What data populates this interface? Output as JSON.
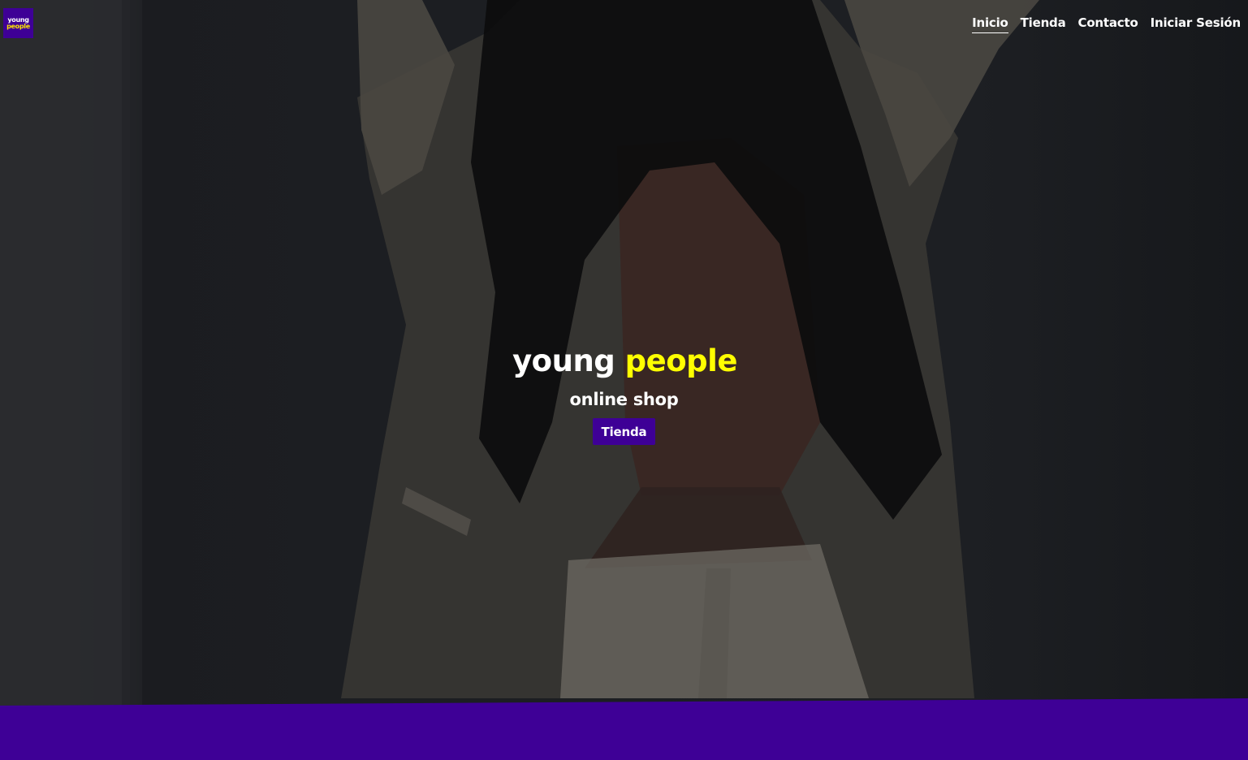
{
  "logo": {
    "line1": "young",
    "line2": "people"
  },
  "nav": {
    "items": [
      {
        "label": "Inicio",
        "active": true
      },
      {
        "label": "Tienda",
        "active": false
      },
      {
        "label": "Contacto",
        "active": false
      },
      {
        "label": "Iniciar Sesión",
        "active": false
      }
    ]
  },
  "hero": {
    "title_part1": "young",
    "title_part2": "people",
    "subtitle": "online shop",
    "button_label": "Tienda"
  },
  "colors": {
    "brand_purple": "#3e0096",
    "accent_yellow": "#ffff00",
    "text": "#ffffff"
  }
}
